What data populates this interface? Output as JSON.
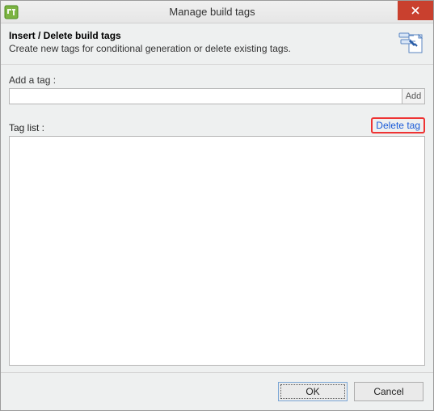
{
  "window": {
    "title": "Manage build tags"
  },
  "header": {
    "title": "Insert / Delete build tags",
    "subtitle": "Create new tags for conditional generation or delete existing tags."
  },
  "addSection": {
    "label": "Add a tag :",
    "input_value": "",
    "input_placeholder": "",
    "button_label": "Add"
  },
  "tagList": {
    "label": "Tag list :",
    "delete_link": "Delete tag",
    "items": []
  },
  "footer": {
    "ok_label": "OK",
    "cancel_label": "Cancel"
  }
}
